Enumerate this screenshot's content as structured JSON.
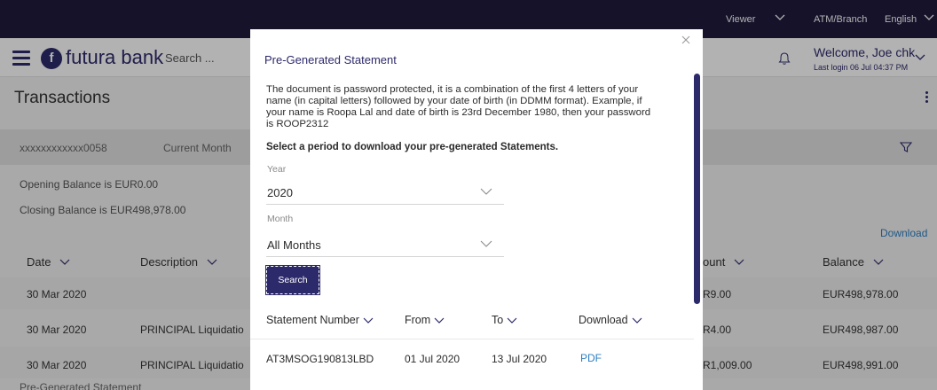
{
  "topbar": {
    "viewer": "Viewer",
    "atm_branch": "ATM/Branch",
    "language": "English"
  },
  "header": {
    "logo_mark": "f",
    "logo_text": "futura bank",
    "search_placeholder": "Search ...",
    "welcome": "Welcome, Joe chk",
    "last_login": "Last login 06 Jul 04:37 PM"
  },
  "page": {
    "title": "Transactions"
  },
  "filter": {
    "account": "xxxxxxxxxxxx0058",
    "period": "Current Month"
  },
  "balances": {
    "opening": "Opening Balance is EUR0.00",
    "closing": "Closing Balance is EUR498,978.00"
  },
  "download_label": "Download",
  "table": {
    "headers": {
      "date": "Date",
      "description": "Description",
      "amount": "ount",
      "balance": "Balance"
    },
    "rows": [
      {
        "date": "30 Mar 2020",
        "description": "",
        "amount": "R9.00",
        "balance": "EUR498,978.00"
      },
      {
        "date": "30 Mar 2020",
        "description": "PRINCIPAL Liquidatio",
        "amount": "R4.00",
        "balance": "EUR498,987.00"
      },
      {
        "date": "30 Mar 2020",
        "description": "PRINCIPAL Liquidatio",
        "amount": "R1,009.00",
        "balance": "EUR498,991.00"
      }
    ]
  },
  "pregenerated_link": "Pre-Generated Statement",
  "modal": {
    "title": "Pre-Generated Statement",
    "description": "The document is password protected, it is a combination of the first 4 letters of your name (in capital letters) followed by your date of birth (in DDMM format). Example, if your name is Roopa Lal and date of birth is 23rd December 1980, then your password is ROOP2312",
    "select_prompt": "Select a period to download your pre-generated Statements.",
    "year_label": "Year",
    "year_value": "2020",
    "month_label": "Month",
    "month_value": "All Months",
    "search_button": "Search",
    "columns": {
      "number": "Statement Number",
      "from": "From",
      "to": "To",
      "download": "Download"
    },
    "rows": [
      {
        "number": "AT3MSOG190813LBD",
        "from": "01 Jul 2020",
        "to": "13 Jul 2020",
        "download": "PDF"
      }
    ]
  }
}
